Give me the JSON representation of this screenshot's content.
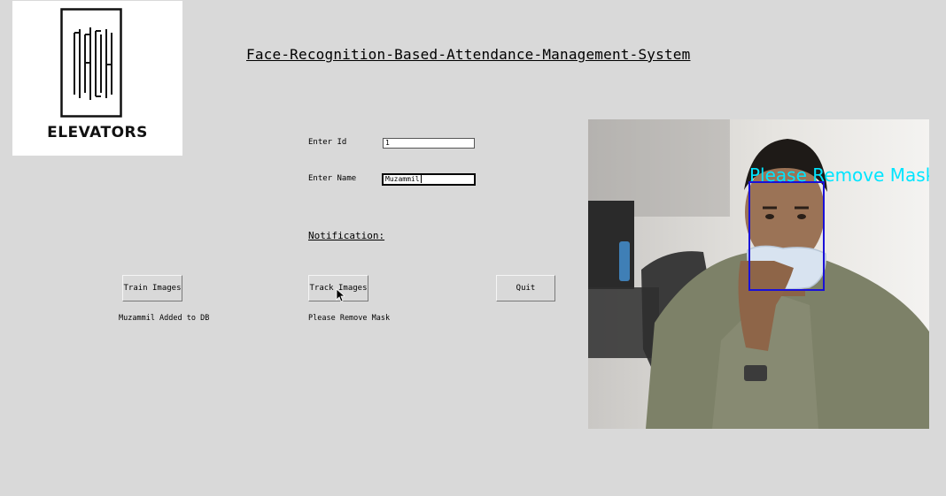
{
  "logo": {
    "brand_text": "ELEVATORS",
    "icon": "elevator-logo-mark"
  },
  "header": {
    "title": "Face-Recognition-Based-Attendance-Management-System"
  },
  "form": {
    "id_label": "Enter Id",
    "id_value": "1",
    "name_label": "Enter Name",
    "name_value": "Muzammil"
  },
  "notification": {
    "label": "Notification:"
  },
  "buttons": {
    "train": "Train Images",
    "track": "Track Images",
    "quit": "Quit"
  },
  "messages": {
    "train_status": "Muzammil Added to DB",
    "track_status": "Please Remove Mask"
  },
  "camera": {
    "overlay_text": "Please Remove Mask",
    "overlay_color": "#00e5ff",
    "box_color": "#1a10d8"
  },
  "colors": {
    "background": "#d9d9d9"
  }
}
